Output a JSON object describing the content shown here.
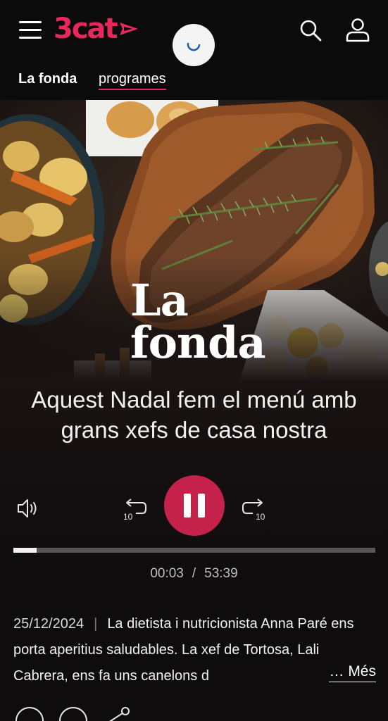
{
  "header": {
    "logo_text": "3cat",
    "brand_color": "#e8285a",
    "menu_icon": "hamburger-icon",
    "search_icon": "search-icon",
    "user_icon": "user-icon",
    "loading_icon": "spinner-icon"
  },
  "subnav": {
    "title": "La fonda",
    "link": "programes"
  },
  "hero": {
    "program_title_line1": "La",
    "program_title_line2": "fonda"
  },
  "episode": {
    "title": "Aquest Nadal fem el menú amb grans xefs de casa nostra",
    "date": "25/12/2024",
    "description": "La dietista i nutricionista Anna Paré ens porta aperitius saludables. La xef de Tortosa, Lali Cabrera, ens fa uns canelons d",
    "more_label": "… Més"
  },
  "player": {
    "current_time": "00:03",
    "separator": "/",
    "duration": "53:39",
    "progress_fraction": 0.065,
    "state": "playing",
    "rewind_seconds": "10",
    "forward_seconds": "10",
    "accent_color": "#c4214b",
    "icons": {
      "volume": "volume-icon",
      "rewind": "rewind-10-icon",
      "pause": "pause-icon",
      "forward": "forward-10-icon"
    }
  }
}
